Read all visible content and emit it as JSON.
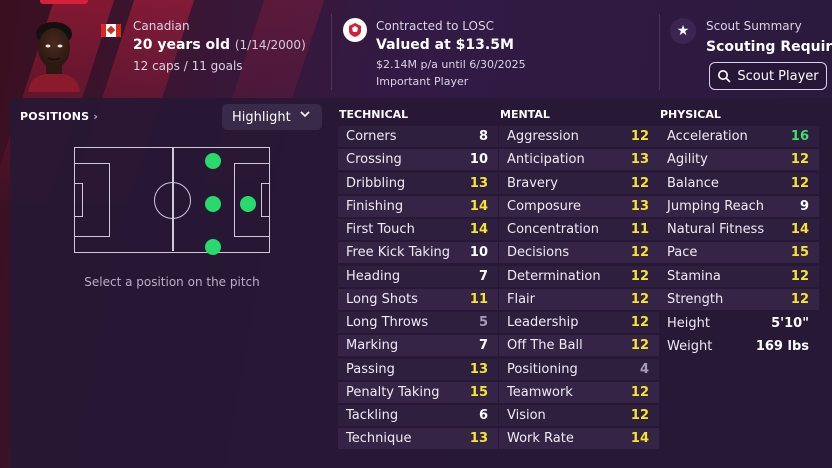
{
  "player": {
    "nationality": "Canadian",
    "age": "20 years old",
    "dob": "(1/14/2000)",
    "caps_goals": "12 caps / 11 goals"
  },
  "contract": {
    "club_line": "Contracted to LOSC",
    "value": "Valued at $13.5M",
    "wage": "$2.14M p/a until 6/30/2025",
    "status": "Important Player"
  },
  "scout": {
    "title": "Scout Summary",
    "summary": "Scouting Required",
    "button_label": "Scout Player"
  },
  "positions": {
    "title": "POSITIONS",
    "dropdown_value": "Highlight",
    "caption": "Select a position on the pitch"
  },
  "technical": {
    "title": "TECHNICAL",
    "rows": [
      {
        "name": "Corners",
        "value": "8"
      },
      {
        "name": "Crossing",
        "value": "10"
      },
      {
        "name": "Dribbling",
        "value": "13"
      },
      {
        "name": "Finishing",
        "value": "14"
      },
      {
        "name": "First Touch",
        "value": "14"
      },
      {
        "name": "Free Kick Taking",
        "value": "10"
      },
      {
        "name": "Heading",
        "value": "7"
      },
      {
        "name": "Long Shots",
        "value": "11"
      },
      {
        "name": "Long Throws",
        "value": "5"
      },
      {
        "name": "Marking",
        "value": "7"
      },
      {
        "name": "Passing",
        "value": "13"
      },
      {
        "name": "Penalty Taking",
        "value": "15"
      },
      {
        "name": "Tackling",
        "value": "6"
      },
      {
        "name": "Technique",
        "value": "13"
      }
    ]
  },
  "mental": {
    "title": "MENTAL",
    "rows": [
      {
        "name": "Aggression",
        "value": "12"
      },
      {
        "name": "Anticipation",
        "value": "13"
      },
      {
        "name": "Bravery",
        "value": "12"
      },
      {
        "name": "Composure",
        "value": "13"
      },
      {
        "name": "Concentration",
        "value": "11"
      },
      {
        "name": "Decisions",
        "value": "12"
      },
      {
        "name": "Determination",
        "value": "12"
      },
      {
        "name": "Flair",
        "value": "12"
      },
      {
        "name": "Leadership",
        "value": "12"
      },
      {
        "name": "Off The Ball",
        "value": "12"
      },
      {
        "name": "Positioning",
        "value": "4"
      },
      {
        "name": "Teamwork",
        "value": "12"
      },
      {
        "name": "Vision",
        "value": "12"
      },
      {
        "name": "Work Rate",
        "value": "14"
      }
    ]
  },
  "physical": {
    "title": "PHYSICAL",
    "rows": [
      {
        "name": "Acceleration",
        "value": "16"
      },
      {
        "name": "Agility",
        "value": "12"
      },
      {
        "name": "Balance",
        "value": "12"
      },
      {
        "name": "Jumping Reach",
        "value": "9"
      },
      {
        "name": "Natural Fitness",
        "value": "14"
      },
      {
        "name": "Pace",
        "value": "15"
      },
      {
        "name": "Stamina",
        "value": "12"
      },
      {
        "name": "Strength",
        "value": "12"
      }
    ],
    "height_label": "Height",
    "height_value": "5'10\"",
    "weight_label": "Weight",
    "weight_value": "169 lbs"
  },
  "colors": {
    "attr_high": "#3fe06a",
    "attr_mid": "#f5e52d",
    "attr_normal": "#ffffff",
    "attr_low": "#a79cb4",
    "position_dot": "#28d96b"
  }
}
